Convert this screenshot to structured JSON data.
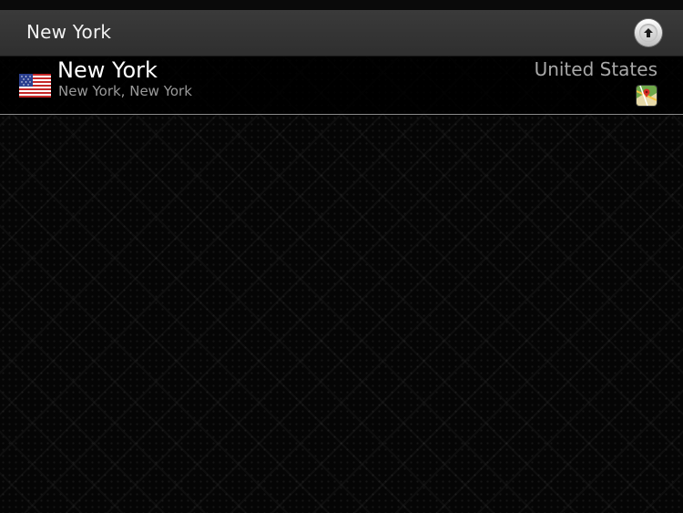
{
  "search": {
    "query": "New York",
    "action_icon": "upload-arrow-icon"
  },
  "result": {
    "city": "New York",
    "subtitle": "New York, New York",
    "country": "United States",
    "flag_icon": "us-flag-icon",
    "map_icon": "map-icon"
  },
  "colors": {
    "background": "#050505",
    "search_bar": "#353535",
    "primary_text": "#ffffff",
    "secondary_text": "#9a9a9a",
    "divider": "#8a8a8a"
  }
}
